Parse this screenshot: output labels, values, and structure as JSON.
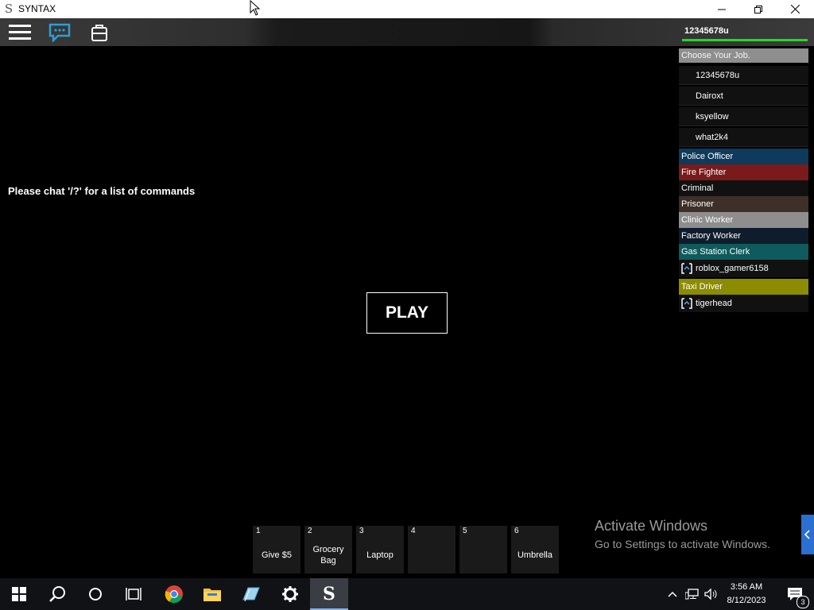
{
  "window": {
    "title": "SYNTAX",
    "app_icon_glyph": "S"
  },
  "topbar": {
    "player_name": "12345678u",
    "health_fraction": 1.0
  },
  "leaderboard": {
    "header": "Choose Your Job.",
    "players": [
      "12345678u",
      "Dairoxt",
      "ksyellow",
      "what2k4"
    ],
    "teams": [
      {
        "name": "Police Officer",
        "color": "#0e3a5c"
      },
      {
        "name": "Fire Fighter",
        "color": "#7a1a1a"
      },
      {
        "name": "Criminal",
        "color": "#111111"
      },
      {
        "name": "Prisoner",
        "color": "#3e3028"
      },
      {
        "name": "Clinic Worker",
        "color": "#8e8e8e"
      },
      {
        "name": "Factory Worker",
        "color": "#0f1c2c"
      },
      {
        "name": "Gas Station Clerk",
        "color": "#0f5a5c"
      },
      {
        "name": "Taxi Driver",
        "color": "#8c8c00"
      }
    ],
    "members": [
      {
        "name": "roblox_gamer6158",
        "after_team": 6
      },
      {
        "name": "tigerhead",
        "after_team": 7
      }
    ]
  },
  "hint": "Please chat '/?' for a list of commands",
  "play_button": "PLAY",
  "hotbar": [
    {
      "num": "1",
      "label": "Give $5"
    },
    {
      "num": "2",
      "label": "Grocery Bag"
    },
    {
      "num": "3",
      "label": "Laptop"
    },
    {
      "num": "4",
      "label": ""
    },
    {
      "num": "5",
      "label": ""
    },
    {
      "num": "6",
      "label": "Umbrella"
    }
  ],
  "watermark": {
    "line1": "Activate Windows",
    "line2": "Go to Settings to activate Windows."
  },
  "taskbar": {
    "time": "3:56 AM",
    "date": "8/12/2023",
    "notification_count": "3"
  },
  "icons": [
    "menu-icon",
    "chat-icon",
    "backpack-icon",
    "windows-start-icon",
    "search-icon",
    "cortana-icon",
    "task-view-icon",
    "chrome-icon",
    "file-explorer-icon",
    "app-icon",
    "settings-icon",
    "syntax-icon",
    "chevron-up-icon",
    "network-icon",
    "volume-icon",
    "notification-icon"
  ]
}
